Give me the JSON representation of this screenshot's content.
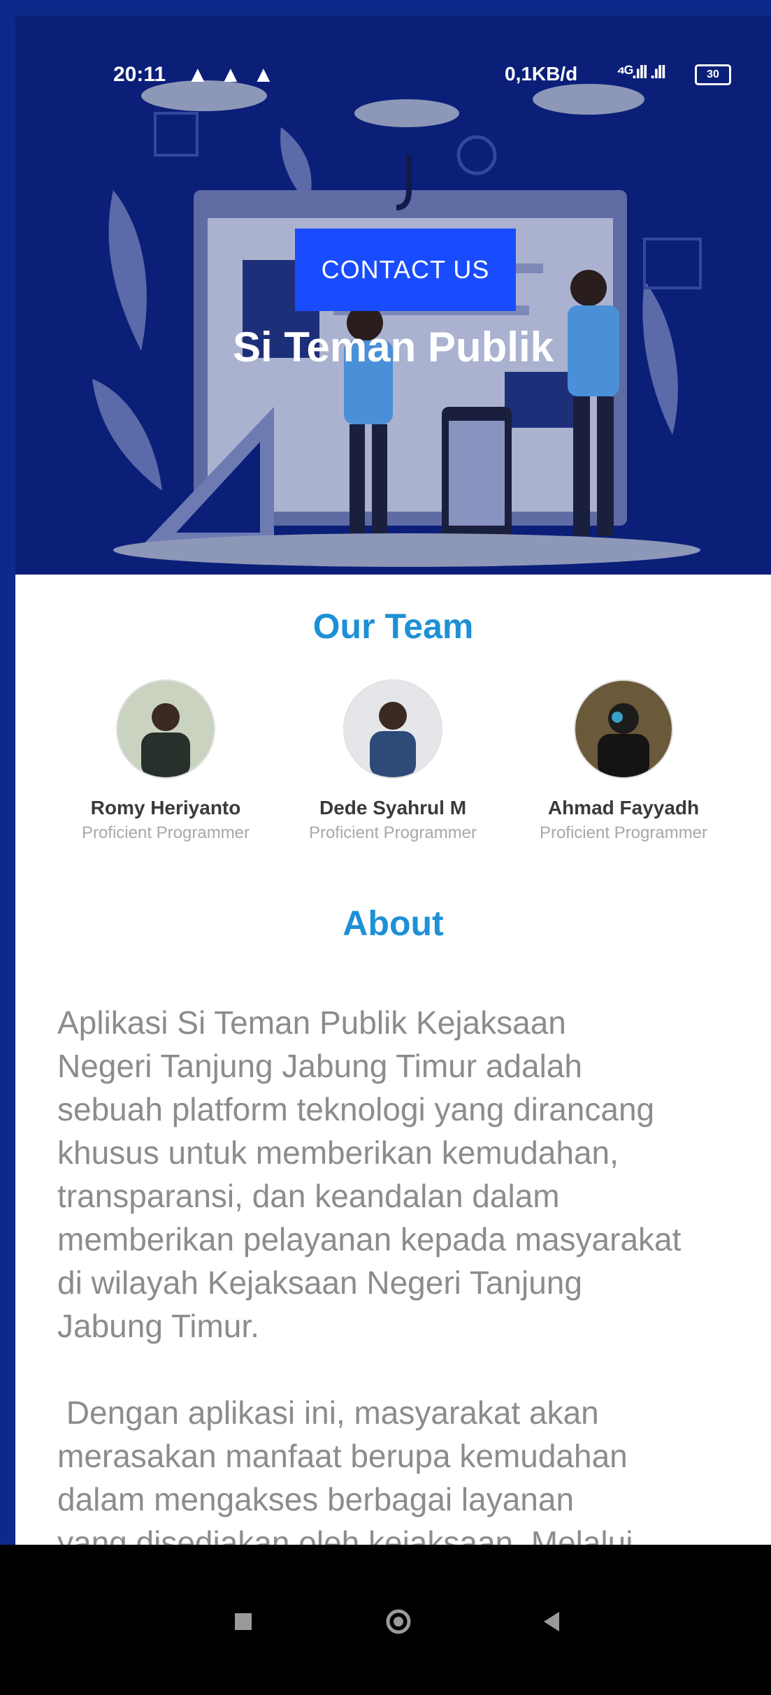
{
  "status_bar": {
    "time": "20:11",
    "warning_icons": [
      "warning-icon",
      "warning-icon",
      "warning-icon"
    ],
    "network_speed": "0,1KB/d",
    "signal_text": "⁴ᴳ.ıll .ıll",
    "battery": "30"
  },
  "hero": {
    "contact_label": "CONTACT US",
    "title": "Si Teman Publik"
  },
  "team": {
    "heading": "Our Team",
    "members": [
      {
        "name": "Romy Heriyanto",
        "role": "Proficient Programmer"
      },
      {
        "name": "Dede Syahrul M",
        "role": "Proficient Programmer"
      },
      {
        "name": "Ahmad Fayyadh",
        "role": "Proficient Programmer"
      }
    ]
  },
  "about": {
    "heading": "About",
    "text": "Aplikasi Si Teman Publik Kejaksaan\nNegeri Tanjung Jabung Timur adalah\nsebuah platform teknologi yang dirancang\nkhusus untuk memberikan kemudahan,\ntransparansi, dan keandalan dalam\nmemberikan pelayanan kepada masyarakat\ndi wilayah Kejaksaan Negeri Tanjung\nJabung Timur.\n\n Dengan aplikasi ini, masyarakat akan\nmerasakan manfaat berupa kemudahan\ndalam mengakses berbagai layanan\nyang disediakan oleh kejaksaan. Melalui\nbeberapa sentuhan di perangkat mereka,\nmereka dapat memperoleh informasi yang"
  },
  "nav": {
    "recent_icon": "square-icon",
    "home_icon": "circle-icon",
    "back_icon": "triangle-back-icon"
  },
  "colors": {
    "hero_bg": "#0b1f78",
    "button": "#1a4cff",
    "heading": "#1e90d6",
    "body_text": "#8c8c8c"
  }
}
